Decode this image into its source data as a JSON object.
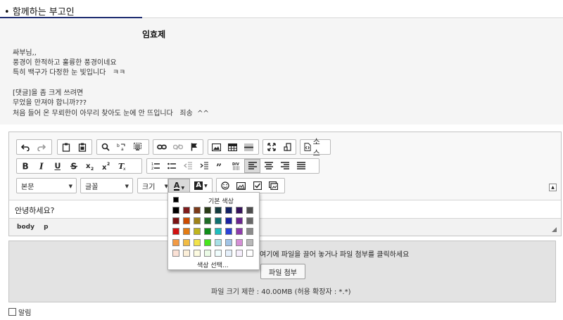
{
  "header": {
    "title": "함께하는 부고인"
  },
  "comment": {
    "author": "임효제",
    "lines": [
      "싸부님,,",
      "풍경이 한적하고 훌륭한 풍경이네요",
      "특히 백구가 다정한 눈 빛입니다   ㅋㅋ",
      "",
      "[댓글]을 좀 크게 쓰려면",
      "무었을 만져야 합니까???",
      "처음 들어 온 무뢰한이 아무리 찾아도 눈에 안 뜨입니다   죄송  ^^"
    ]
  },
  "toolbar": {
    "source_label": "소스",
    "format_select": "본문",
    "font_select": "글꼴",
    "size_select": "크기",
    "text_color_letter": "A",
    "bg_color_letter": "A"
  },
  "editor": {
    "content": "안녕하세요?",
    "path": [
      "body",
      "p"
    ]
  },
  "upload": {
    "hint": "여기에 파일을 끌어 놓거나 파일 첨부를 클릭하세요",
    "attach_button": "파일 첨부",
    "limit": "파일 크기 제한 : 40.00MB (허용 확장자 : *.*)"
  },
  "alarm": {
    "label": "알림"
  },
  "color_panel": {
    "auto_label": "기본 색상",
    "more_label": "색상 선택...",
    "auto_color": "#000000",
    "rows": [
      [
        "#000000",
        "#7f1c1c",
        "#7b3a1a",
        "#2a3a17",
        "#143a3d",
        "#132263",
        "#35125a",
        "#4d4d4d"
      ],
      [
        "#7a1213",
        "#cc4b00",
        "#9f8219",
        "#1f6b27",
        "#0f7070",
        "#1a23a1",
        "#6a248e",
        "#686868"
      ],
      [
        "#d11111",
        "#e37b12",
        "#c0b51e",
        "#0f8d19",
        "#1fbdbd",
        "#2b42d6",
        "#8e3bab",
        "#8b8b8b"
      ],
      [
        "#f29a44",
        "#f2bc43",
        "#f2e34a",
        "#47e51e",
        "#a8e0e6",
        "#a1c4e6",
        "#d58fd6",
        "#b9b9b9"
      ],
      [
        "#fbe1d5",
        "#fcefd8",
        "#fdfbe0",
        "#ebfbe6",
        "#effdfd",
        "#e5f0fb",
        "#f6eefc",
        "#ffffff"
      ]
    ]
  }
}
